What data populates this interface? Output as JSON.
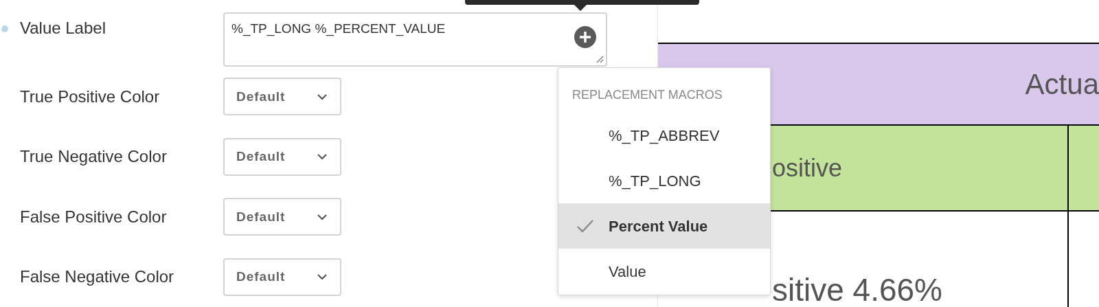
{
  "form": {
    "fields": [
      {
        "kind": "textarea",
        "label": "Value Label",
        "value": "%_TP_LONG %_PERCENT_VALUE"
      },
      {
        "kind": "select",
        "label": "True Positive Color",
        "value": "Default"
      },
      {
        "kind": "select",
        "label": "True Negative Color",
        "value": "Default"
      },
      {
        "kind": "select",
        "label": "False Positive Color",
        "value": "Default"
      },
      {
        "kind": "select",
        "label": "False Negative Color",
        "value": "Default"
      }
    ]
  },
  "macro_menu": {
    "title": "REPLACEMENT MACROS",
    "items": [
      {
        "label": "%_TP_ABBREV",
        "selected": false
      },
      {
        "label": "%_TP_LONG",
        "selected": false
      },
      {
        "label": "Percent Value",
        "selected": true
      },
      {
        "label": "Value",
        "selected": false
      }
    ]
  },
  "table": {
    "header": "Actua",
    "subheader": "ositive",
    "cell": "sitive 4.66%"
  }
}
